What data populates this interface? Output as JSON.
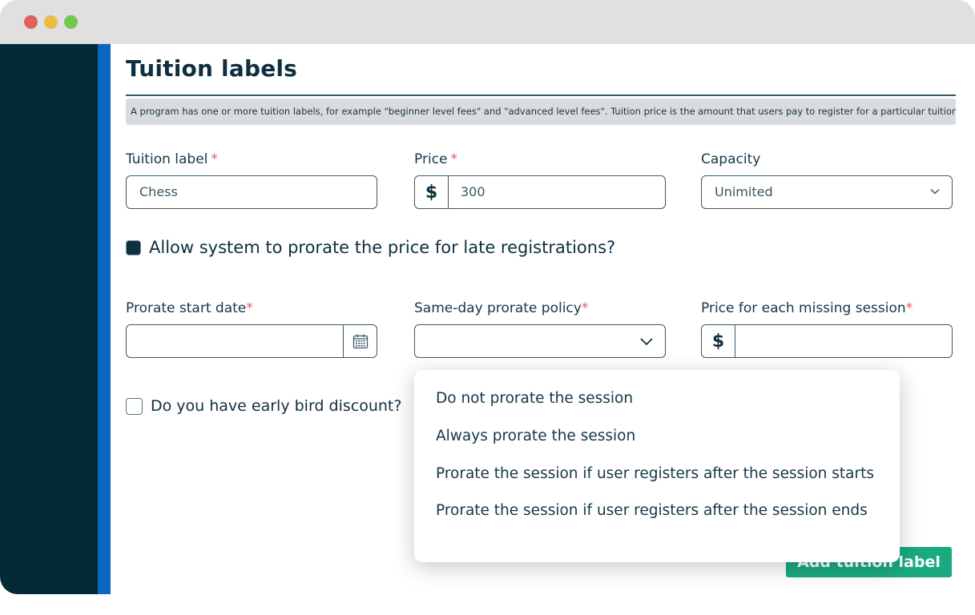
{
  "window": {
    "controls": [
      "close",
      "minimize",
      "maximize"
    ]
  },
  "colors": {
    "sidebar": "#032a37",
    "accent": "#0b66bd",
    "primary_button": "#19aa80",
    "required": "#e25a5a",
    "text": "#0e2f3f"
  },
  "page": {
    "title": "Tuition labels",
    "info": "A program has one or more tuition labels, for example \"beginner level fees\" and \"advanced level fees\". Tuition price is the amount that users pay to register for a particular tuition label."
  },
  "form": {
    "tuition_label": {
      "label": "Tuition label",
      "required_mark": "*",
      "value": "Chess"
    },
    "price": {
      "label": "Price",
      "required_mark": "*",
      "prefix": "$",
      "value": "300"
    },
    "capacity": {
      "label": "Capacity",
      "value": "Unimited",
      "icon": "chevron-down-icon"
    },
    "prorate_checkbox": {
      "label": "Allow system to prorate the price for late registrations?",
      "checked": true
    },
    "prorate_start_date": {
      "label": "Prorate start date",
      "required_mark": "*",
      "value": "",
      "icon": "calendar-icon"
    },
    "same_day_policy": {
      "label": "Same-day prorate policy",
      "required_mark": "*",
      "value": "",
      "icon": "chevron-down-icon",
      "expanded": true,
      "options": [
        "Do not prorate the session",
        "Always prorate the session",
        "Prorate the session if user registers after the session starts",
        "Prorate the session if user registers after the session ends"
      ]
    },
    "missing_session_price": {
      "label": "Price for each missing session",
      "required_mark": "*",
      "prefix": "$",
      "value": ""
    },
    "early_bird_checkbox": {
      "label": "Do you have early bird discount?",
      "checked": false
    },
    "add_button": "Add tuition label"
  }
}
